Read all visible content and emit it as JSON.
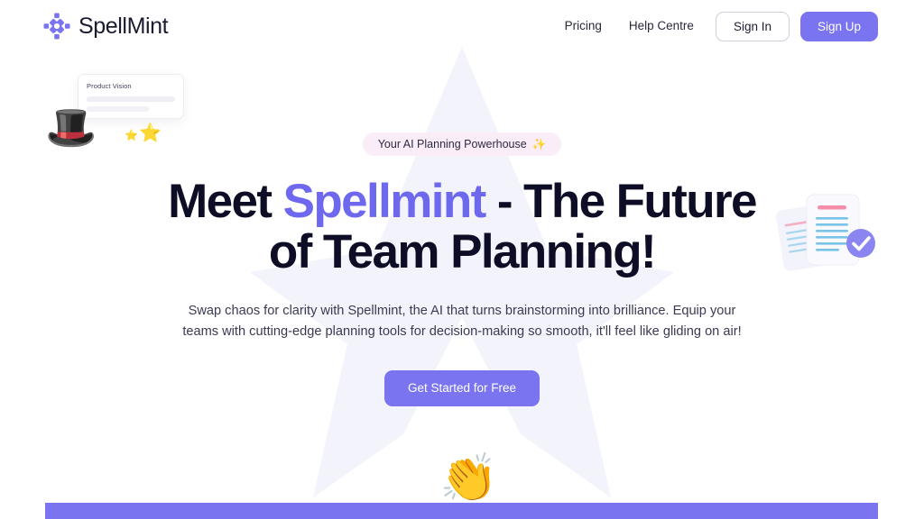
{
  "brand": {
    "name": "SpellMint",
    "logo_icon": "spellmint-diamond-logo",
    "accent_color": "#7A74F0",
    "headline_accent_color": "#6E68EE"
  },
  "header": {
    "nav_links": [
      {
        "label": "Pricing"
      },
      {
        "label": "Help Centre"
      }
    ],
    "sign_in_label": "Sign In",
    "sign_up_label": "Sign Up"
  },
  "left_illustration": {
    "card_title": "Product Vision",
    "hat_emoji": "🎩",
    "small_star_emoji": "⭐",
    "big_star_emoji": "⭐"
  },
  "right_illustration": {
    "icon": "documents-with-check-badge"
  },
  "hero": {
    "badge_text": "Your AI Planning Powerhouse",
    "badge_emoji": "✨",
    "headline_part1": "Meet ",
    "headline_accent": "Spellmint",
    "headline_part2": " - The Future of Team Planning!",
    "subtext": "Swap chaos for clarity with Spellmint, the AI that turns brainstorming into brilliance. Equip your teams with cutting-edge planning tools for decision-making so smooth, it'll feel like gliding on air!",
    "cta_label": "Get Started for Free"
  },
  "bottom": {
    "clap_emoji": "👏",
    "bar_color": "#7A74F0"
  }
}
